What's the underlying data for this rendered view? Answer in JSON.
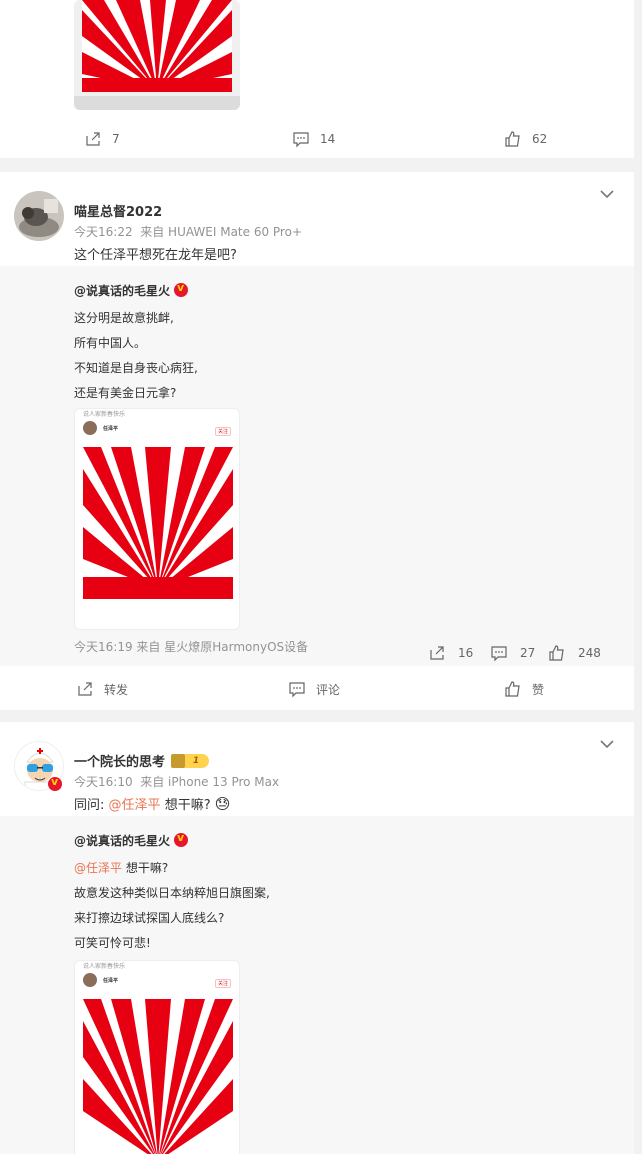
{
  "card1": {
    "repost_count": "7",
    "comment_count": "14",
    "like_count": "62"
  },
  "post2": {
    "username": "喵星总督2022",
    "time": "今天16:22",
    "source": "来自 HUAWEI Mate 60 Pro+",
    "text": "这个任泽平想死在龙年是吧?",
    "repost": {
      "author": "@说真话的毛星火",
      "lines": [
        "这分明是故意挑衅,",
        "所有中国人。",
        "不知道是自身丧心病狂,",
        "还是有美金日元拿?"
      ],
      "image": {
        "mini_name": "任泽平",
        "mini_follow": "关注",
        "mini_top": "说人家新春快乐"
      },
      "time": "今天16:19",
      "source": "来自 星火燎原HarmonyOS设备",
      "repost_count": "16",
      "comment_count": "27",
      "like_count": "248"
    },
    "actions": {
      "repost": "转发",
      "comment": "评论",
      "like": "赞"
    }
  },
  "post3": {
    "username": "一个院长的思考",
    "level_badge": "1",
    "time": "今天16:10",
    "source": "来自 iPhone 13 Pro Max",
    "text_prefix": "同问:",
    "mention": "@任泽平",
    "text_suffix": "想干嘛?",
    "emoji": "😓",
    "repost": {
      "author": "@说真话的毛星火",
      "line1_mention": "@任泽平",
      "line1_suffix": "想干嘛?",
      "lines": [
        "故意发这种类似日本纳粹旭日旗图案,",
        "来打擦边球试探国人底线么?",
        "可笑可怜可悲!"
      ],
      "image": {
        "mini_name": "任泽平",
        "mini_follow": "关注",
        "mini_top": "说人家新春快乐"
      }
    }
  },
  "colors": {
    "accent": "#eb7350",
    "sun_red": "#e60012",
    "page_bg": "#f2f2f2"
  }
}
